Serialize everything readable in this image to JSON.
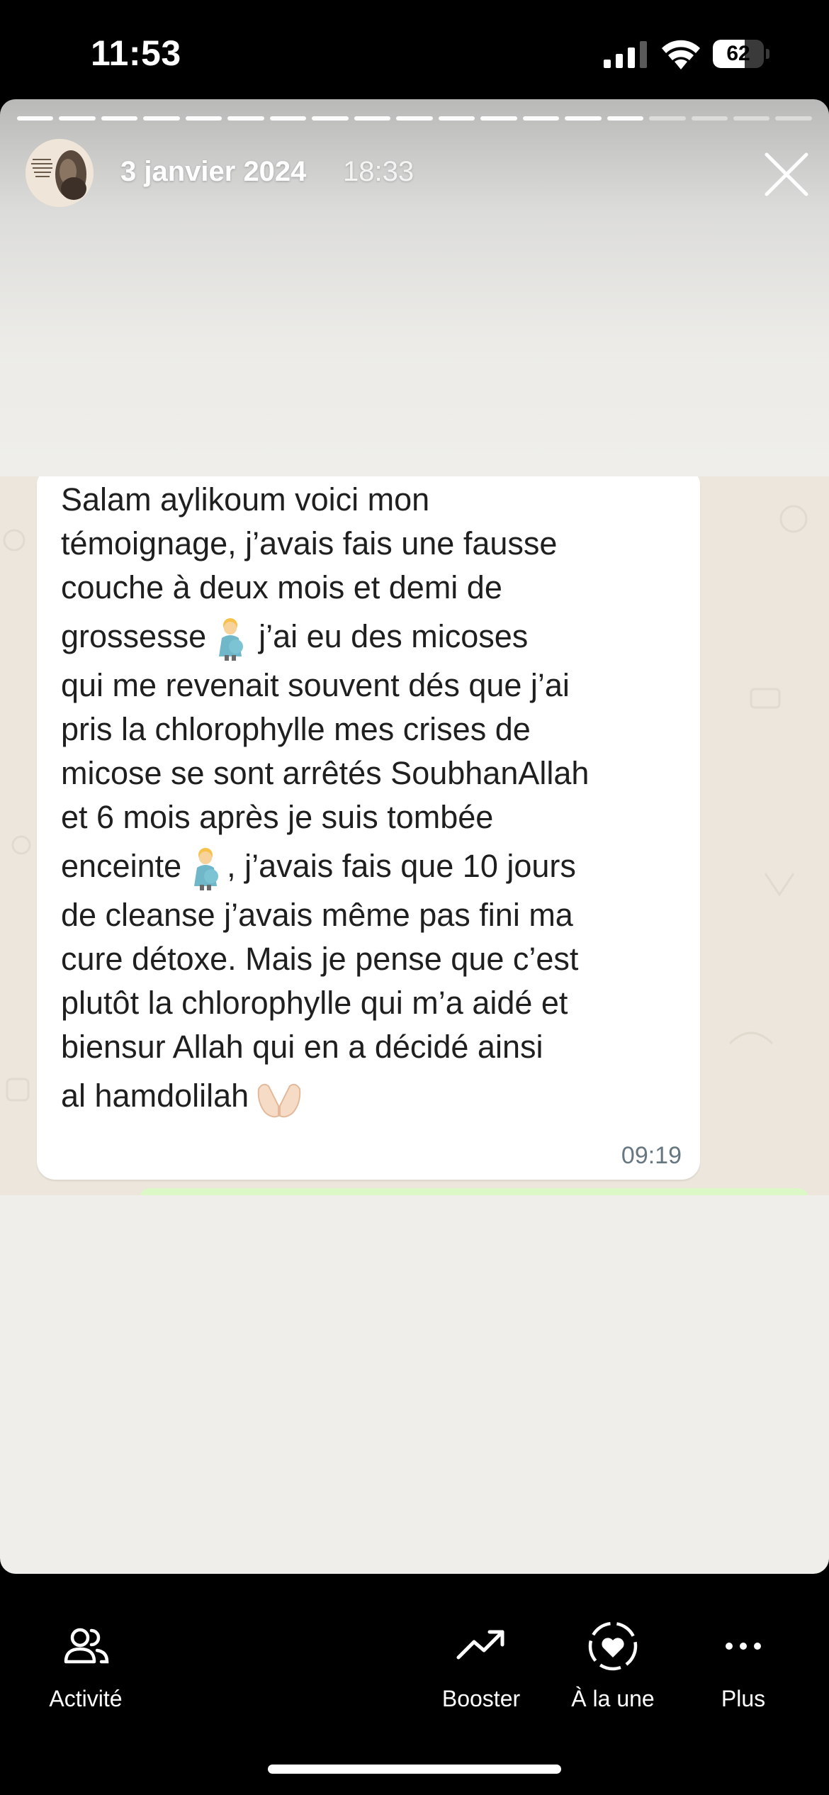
{
  "status_bar": {
    "time": "11:53",
    "battery": "62",
    "battery_level": 0.62
  },
  "story": {
    "date": "3 janvier 2024",
    "time": "18:33",
    "segments_total": 19,
    "segments_done": 15
  },
  "message": {
    "lines": [
      "Salam aylikoum voici mon",
      "témoignage, j’avais fais une fausse",
      "couche à deux mois et demi de",
      "grossesse",
      "j’ai eu des micoses",
      "qui me revenait souvent dés que j’ai",
      "pris la chlorophylle mes crises de",
      "micose se sont arrêtés SoubhanAllah",
      "et 6 mois après je suis tombée",
      "enceinte",
      ", j’avais fais que 10 jours",
      "de cleanse j’avais même pas fini ma",
      "cure détoxe. Mais je pense que c’est",
      "plutôt la chlorophylle qui m’a aidé et",
      "biensur Allah qui en a décidé ainsi",
      "al hamdolilah"
    ],
    "time": "09:19"
  },
  "bottom_bar": {
    "activity": "Activité",
    "boost": "Booster",
    "highlight": "À la une",
    "more": "Plus"
  }
}
